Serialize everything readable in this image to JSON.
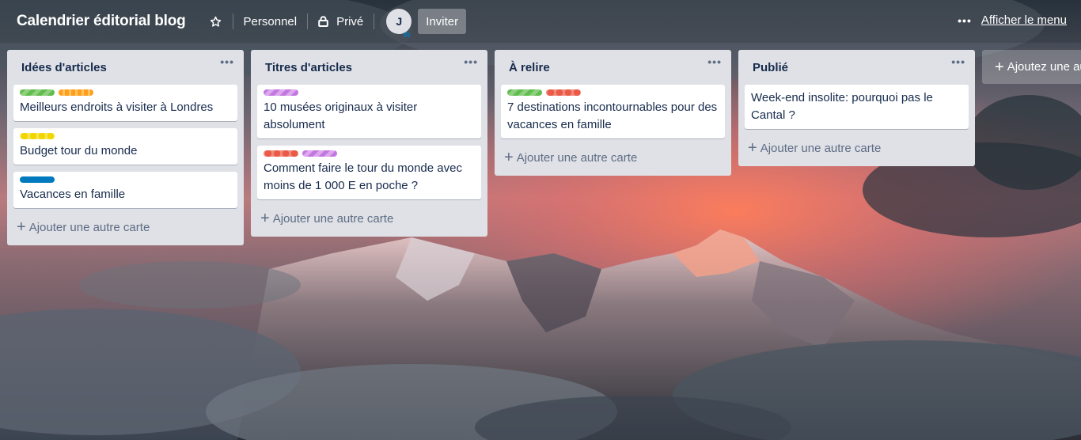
{
  "header": {
    "title": "Calendrier éditorial blog",
    "team": "Personnel",
    "privacy": "Privé",
    "avatar_initial": "J",
    "invite": "Inviter",
    "menu": "Afficher le menu"
  },
  "lists": [
    {
      "title": "Idées d'articles",
      "cards": [
        {
          "title": "Meilleurs endroits à visiter à Londres",
          "labels": [
            "#61bd4f",
            "#ff9f1a"
          ]
        },
        {
          "title": "Budget tour du monde",
          "labels": [
            "#f2d600"
          ]
        },
        {
          "title": "Vacances en famille",
          "labels": [
            "#0079bf"
          ]
        }
      ],
      "add_card": "Ajouter une autre carte"
    },
    {
      "title": "Titres d'articles",
      "cards": [
        {
          "title": "10 musées originaux à visiter absolument",
          "labels": [
            "#c377e0"
          ]
        },
        {
          "title": "Comment faire le tour du monde avec moins de 1 000 E en poche ?",
          "labels": [
            "#eb5a46",
            "#c377e0"
          ]
        }
      ],
      "add_card": "Ajouter une autre carte"
    },
    {
      "title": "À relire",
      "cards": [
        {
          "title": "7 destinations incontournables pour des vacances en famille",
          "labels": [
            "#61bd4f",
            "#eb5a46"
          ]
        }
      ],
      "add_card": "Ajouter une autre carte"
    },
    {
      "title": "Publié",
      "cards": [
        {
          "title": "Week-end insolite: pourquoi pas le Cantal ?",
          "labels": []
        }
      ],
      "add_card": "Ajouter une autre carte"
    }
  ],
  "add_list": "Ajoutez une autre liste",
  "icons": {
    "star": "star-icon",
    "lock": "lock-icon",
    "more": "more-dots-icon",
    "plus": "plus-icon"
  }
}
